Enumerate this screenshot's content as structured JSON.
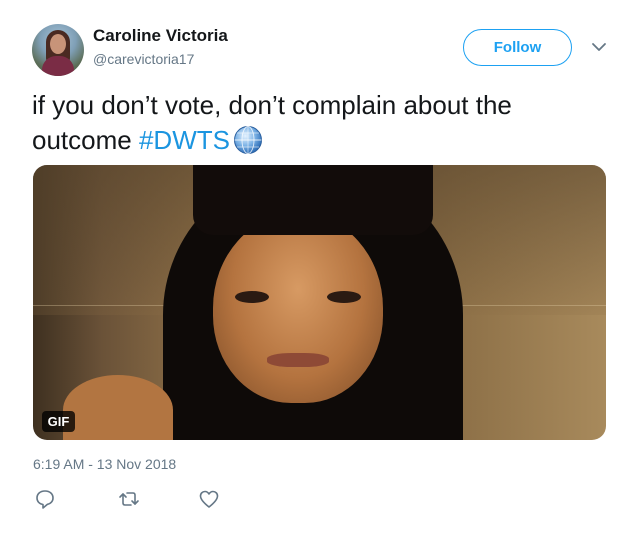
{
  "author": {
    "display_name": "Caroline Victoria",
    "username": "@carevictoria17"
  },
  "header": {
    "follow_label": "Follow"
  },
  "tweet": {
    "text_plain": "if you don’t vote, don’t complain about the outcome ",
    "hashtag": "#DWTS",
    "emoji_icon": "globe-icon"
  },
  "media": {
    "badge": "GIF"
  },
  "timestamp": "6:19 AM - 13 Nov 2018",
  "actions": {
    "reply_icon": "reply-icon",
    "retweet_icon": "retweet-icon",
    "like_icon": "heart-icon"
  },
  "colors": {
    "accent": "#1da1f2",
    "hashtag": "#1b95e0",
    "muted": "#657786",
    "text": "#14171a"
  }
}
